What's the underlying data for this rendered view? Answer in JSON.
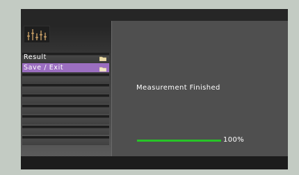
{
  "menu": {
    "items": [
      {
        "label": "Result",
        "icon": "folder-icon",
        "selected": false
      },
      {
        "label": "Save / Exit",
        "icon": "folder-icon",
        "selected": true
      }
    ],
    "empty_slots": 6
  },
  "status": {
    "message": "Measurement Finished"
  },
  "progress": {
    "value": 1.0,
    "label": "100%"
  },
  "colors": {
    "accent_selected": "#9b6ec0",
    "progress_green": "#27c427",
    "background": "#c3cbc3"
  },
  "logo": {
    "icon": "equalizer-logo-icon"
  }
}
